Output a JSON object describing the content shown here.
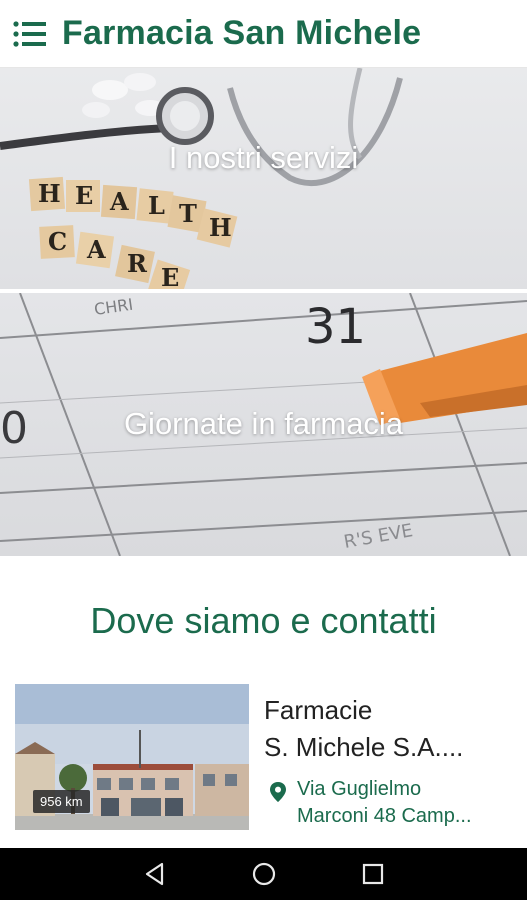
{
  "app_bar": {
    "title": "Farmacia San Michele",
    "menu_icon": "hamburger-menu-icon",
    "title_color": "#1b6b4d"
  },
  "banners": [
    {
      "label": "I nostri servizi"
    },
    {
      "label": "Giornate in farmacia"
    }
  ],
  "contacts_section": {
    "title": "Dove siamo e contatti"
  },
  "location_card": {
    "name_line1": "Farmacie",
    "name_line2": "S. Michele S.A....",
    "distance": "956 km",
    "address_line1": "Via Guglielmo",
    "address_line2": "Marconi 48 Camp...",
    "pin_icon": "location-pin-icon"
  },
  "nav_bar": {
    "back_icon": "back-triangle-icon",
    "home_icon": "home-circle-icon",
    "recents_icon": "recents-square-icon"
  }
}
